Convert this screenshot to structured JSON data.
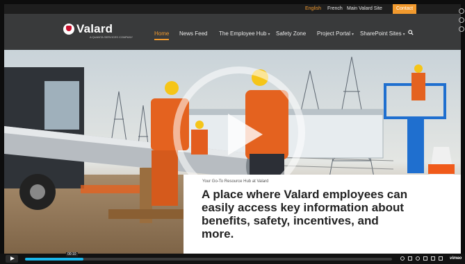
{
  "utility_nav": {
    "links": [
      "English",
      "French",
      "Main Valard Site"
    ],
    "contact_label": "Contact"
  },
  "header": {
    "logo_text": "Valard",
    "logo_tagline": "A QUANTA SERVICES COMPANY",
    "nav": [
      {
        "label": "Home"
      },
      {
        "label": "News Feed"
      },
      {
        "label": "The Employee Hub"
      },
      {
        "label": "Safety Zone"
      },
      {
        "label": "Project Portal"
      },
      {
        "label": "SharePoint Sites"
      }
    ],
    "search_icon": "search-icon"
  },
  "hero": {
    "eyebrow": "Your Go-To Resource Hub at Valard",
    "headline": "A place where Valard employees can easily access key information about benefits, safety, incentives, and more."
  },
  "player": {
    "timecode": "00:10",
    "progress": 0.16,
    "brand": "vimeo"
  },
  "colors": {
    "accent": "#f29a2e",
    "player_progress": "#1ab7ea",
    "nav_bg": "#2d2d2d"
  }
}
